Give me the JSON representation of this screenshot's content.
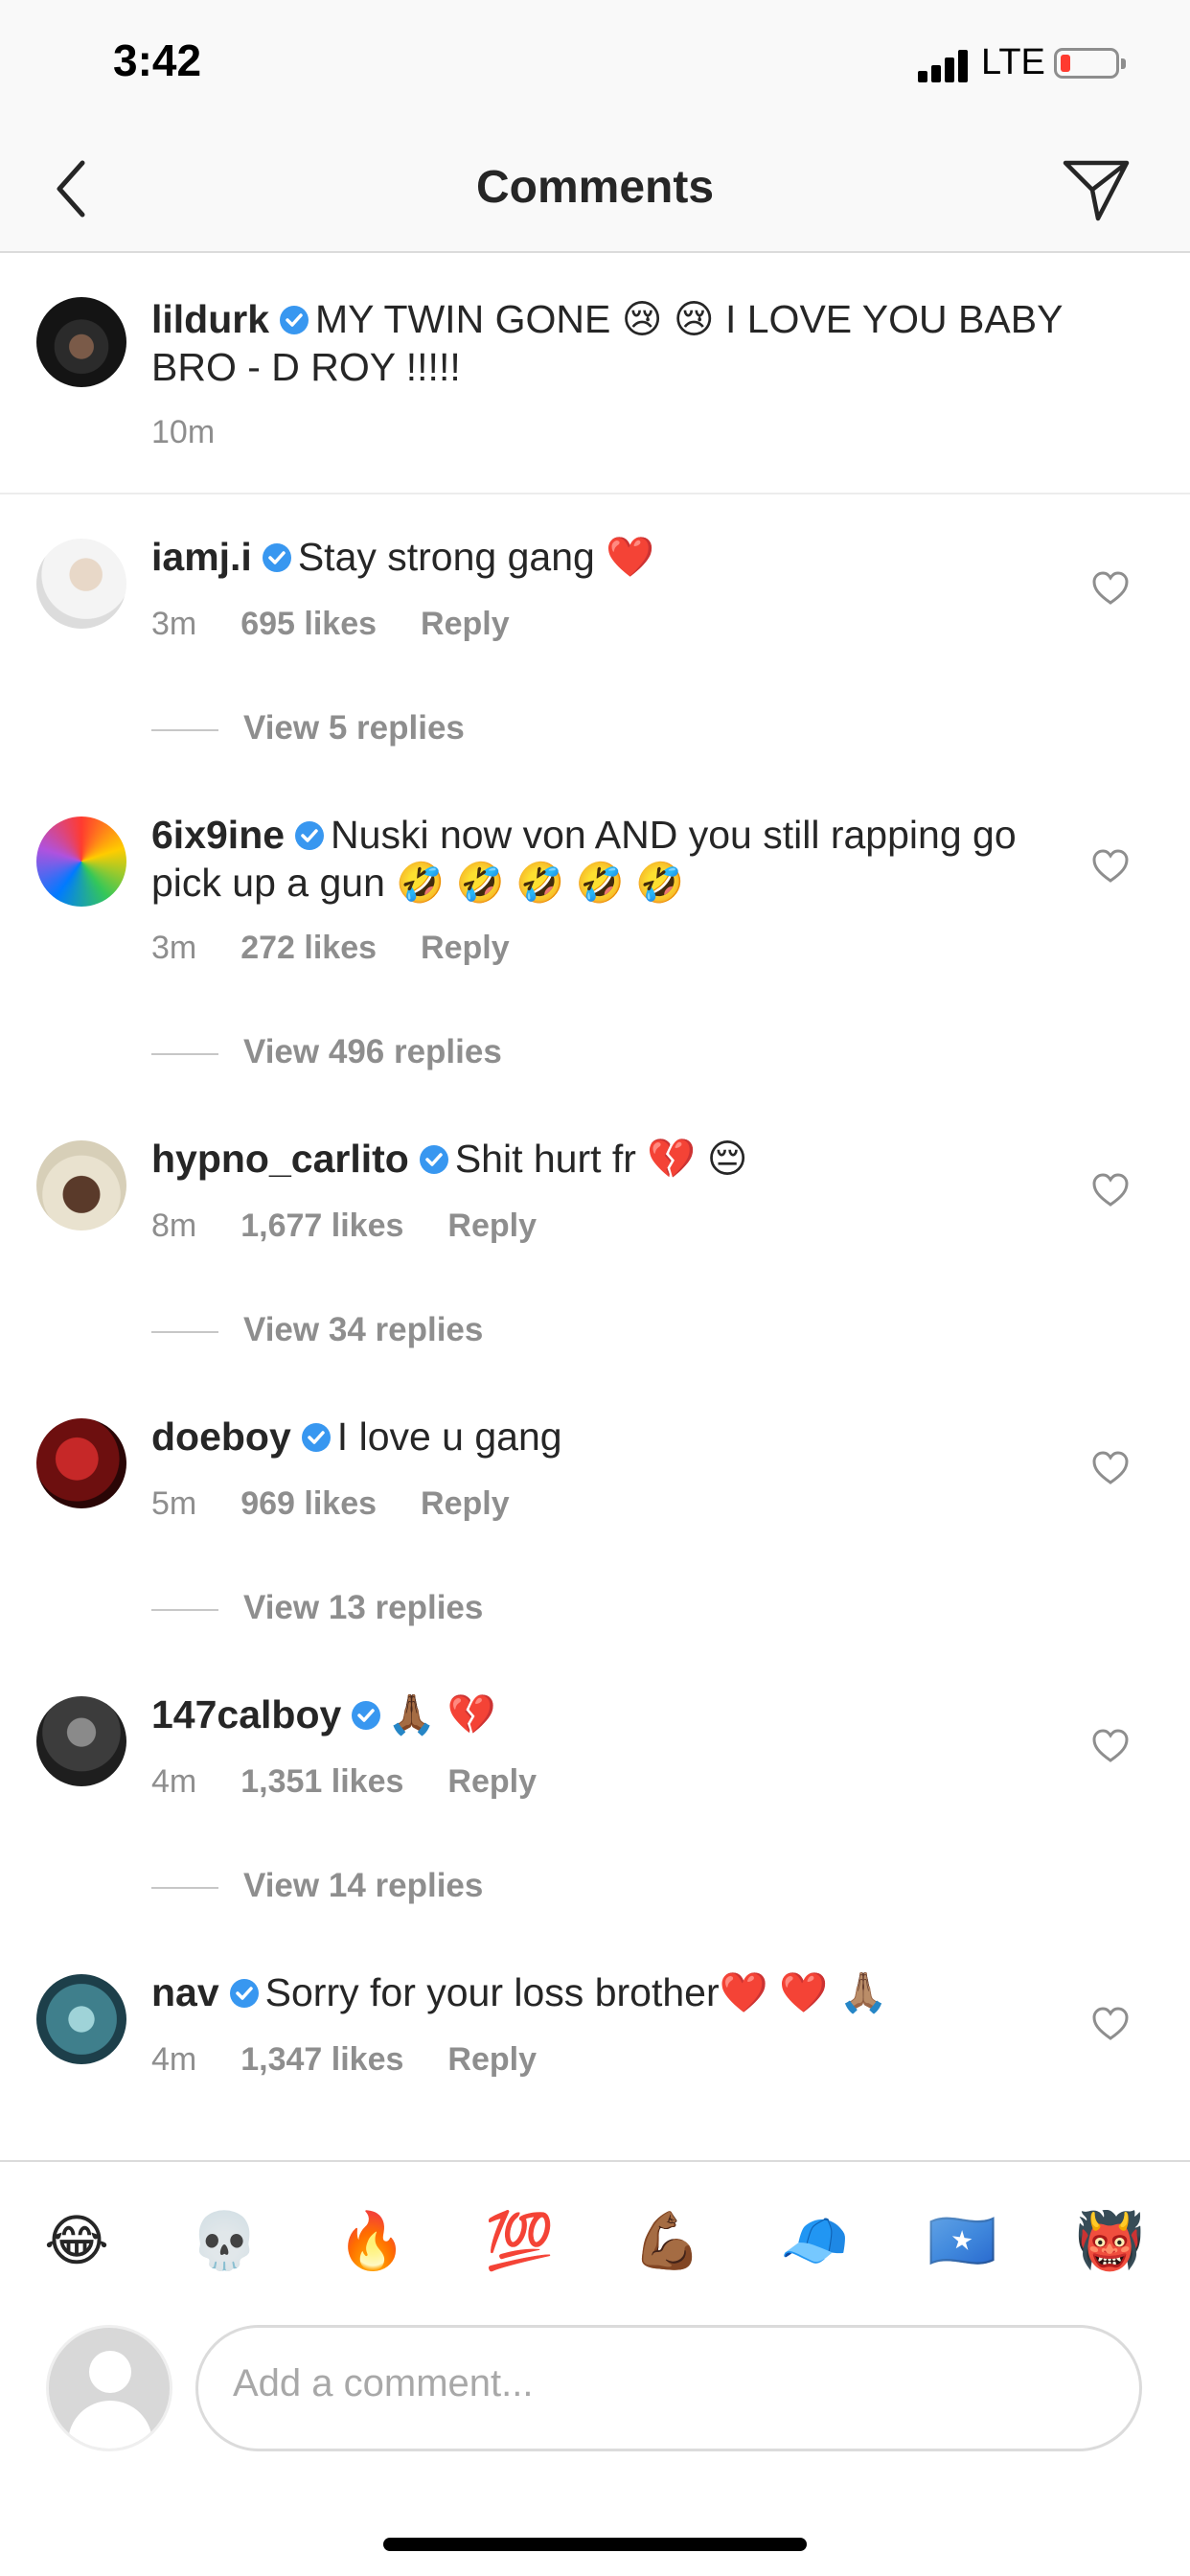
{
  "status": {
    "time": "3:42",
    "network": "LTE"
  },
  "nav": {
    "title": "Comments"
  },
  "caption": {
    "username": "lildurk",
    "text": "MY TWIN GONE 😢 😢 I LOVE YOU BABY BRO - D ROY !!!!!",
    "time": "10m"
  },
  "comments": [
    {
      "username": "iamj.i",
      "text": "Stay strong gang ❤️",
      "time": "3m",
      "likes": "695 likes",
      "reply": "Reply",
      "view_replies": "View 5 replies"
    },
    {
      "username": "6ix9ine",
      "text": "Nuski now von AND you still rapping go pick up a gun 🤣 🤣 🤣 🤣 🤣",
      "time": "3m",
      "likes": "272 likes",
      "reply": "Reply",
      "view_replies": "View 496 replies"
    },
    {
      "username": "hypno_carlito",
      "text": "Shit hurt fr 💔 😔",
      "time": "8m",
      "likes": "1,677 likes",
      "reply": "Reply",
      "view_replies": "View 34 replies"
    },
    {
      "username": "doeboy",
      "text": "I love u gang",
      "time": "5m",
      "likes": "969 likes",
      "reply": "Reply",
      "view_replies": "View 13 replies"
    },
    {
      "username": "147calboy",
      "text": "🙏🏾 💔",
      "time": "4m",
      "likes": "1,351 likes",
      "reply": "Reply",
      "view_replies": "View 14 replies"
    },
    {
      "username": "nav",
      "text": "Sorry for your loss brother❤️ ❤️ 🙏🏽",
      "time": "4m",
      "likes": "1,347 likes",
      "reply": "Reply",
      "view_replies": ""
    }
  ],
  "quick_emojis": [
    "😂",
    "💀",
    "🔥",
    "💯",
    "💪🏾",
    "🧢",
    "🇸🇴",
    "👹"
  ],
  "composer": {
    "placeholder": "Add a comment..."
  },
  "colors": {
    "verified": "#3897f0",
    "meta": "#8e8e8e",
    "text": "#262626"
  }
}
